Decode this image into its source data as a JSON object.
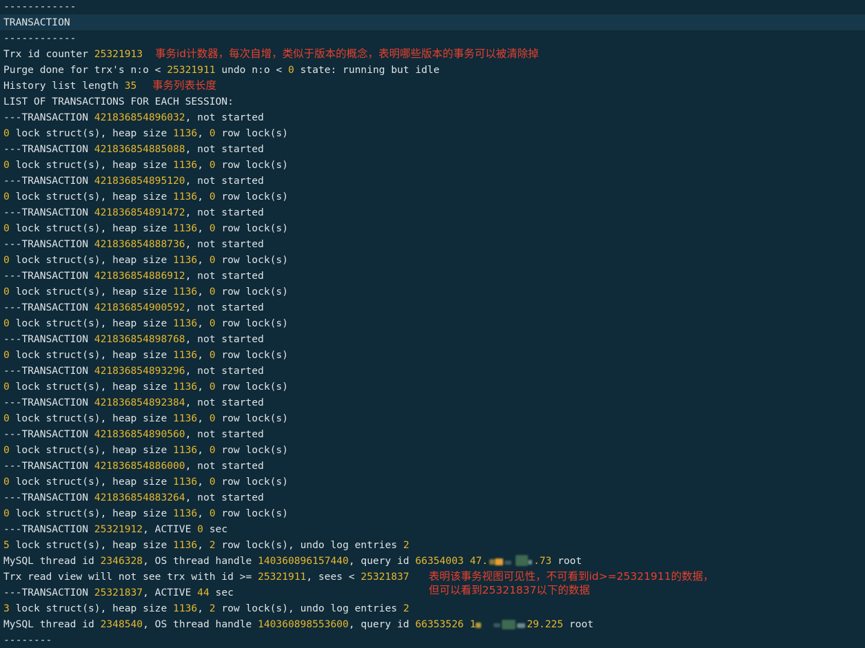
{
  "colors": {
    "background": "#0f2a38",
    "text": "#dfe5e8",
    "number": "#e8b92f",
    "annotation": "#e8412e",
    "section_highlight": "#17384a"
  },
  "dash_top": "------------",
  "section_title": "TRANSACTION",
  "dash_mid": "------------",
  "trx_counter": {
    "prefix": "Trx id counter ",
    "value": "25321913"
  },
  "note_counter": "事务id计数器，每次自增，类似于版本的概念，表明哪些版本的事务可以被清除掉",
  "purge": {
    "p1": "Purge done for trx's n:o < ",
    "v1": "25321911",
    "p2": " undo n:o < ",
    "v2": "0",
    "p3": " state: running but idle"
  },
  "history": {
    "prefix": "History list length ",
    "value": "35"
  },
  "note_history": "事务列表长度",
  "list_header": "LIST OF TRANSACTIONS FOR EACH SESSION:",
  "tx_prefix": "---TRANSACTION ",
  "not_started": ", not started",
  "lock_labels": {
    "structs": " lock struct(s), heap size ",
    "row_locks": " row lock(s)",
    "undo": ", undo log entries "
  },
  "idle_locks": {
    "structs": "0",
    "heap": "1136",
    "rows": "0"
  },
  "idle_transactions": [
    "421836854896032",
    "421836854885088",
    "421836854895120",
    "421836854891472",
    "421836854888736",
    "421836854886912",
    "421836854900592",
    "421836854898768",
    "421836854893296",
    "421836854892384",
    "421836854890560",
    "421836854886000",
    "421836854883264"
  ],
  "active_1": {
    "id": "25321912",
    "status": ", ACTIVE ",
    "secs": "0",
    "sec_label": " sec",
    "structs": "5",
    "heap": "1136",
    "rows": "2",
    "undo": "2",
    "thread": {
      "p1": "MySQL thread id ",
      "id": "2346328",
      "p2": ", OS thread handle ",
      "handle": "140360896157440",
      "p3": ", query id ",
      "query": "66354003",
      "ip_head": "47.",
      "ip_tail": ".73",
      "user": " root"
    },
    "read_view": {
      "p1": "Trx read view will not see trx with id >= ",
      "v1": "25321911",
      "p2": ", sees < ",
      "v2": "25321837"
    }
  },
  "note_view_1": "表明该事务视图可见性，不可看到id>=25321911的数据，",
  "note_view_2": "但可以看到25321837以下的数据",
  "active_2": {
    "id": "25321837",
    "status": ", ACTIVE ",
    "secs": "44",
    "sec_label": " sec",
    "structs": "3",
    "heap": "1136",
    "rows": "2",
    "undo": "2",
    "thread": {
      "p1": "MySQL thread id ",
      "id": "2348540",
      "p2": ", OS thread handle ",
      "handle": "140360898553600",
      "p3": ", query id ",
      "query": "66353526",
      "ip_head": "1",
      "ip_tail": "29.225",
      "user": " root"
    }
  },
  "dash_bottom": "--------"
}
